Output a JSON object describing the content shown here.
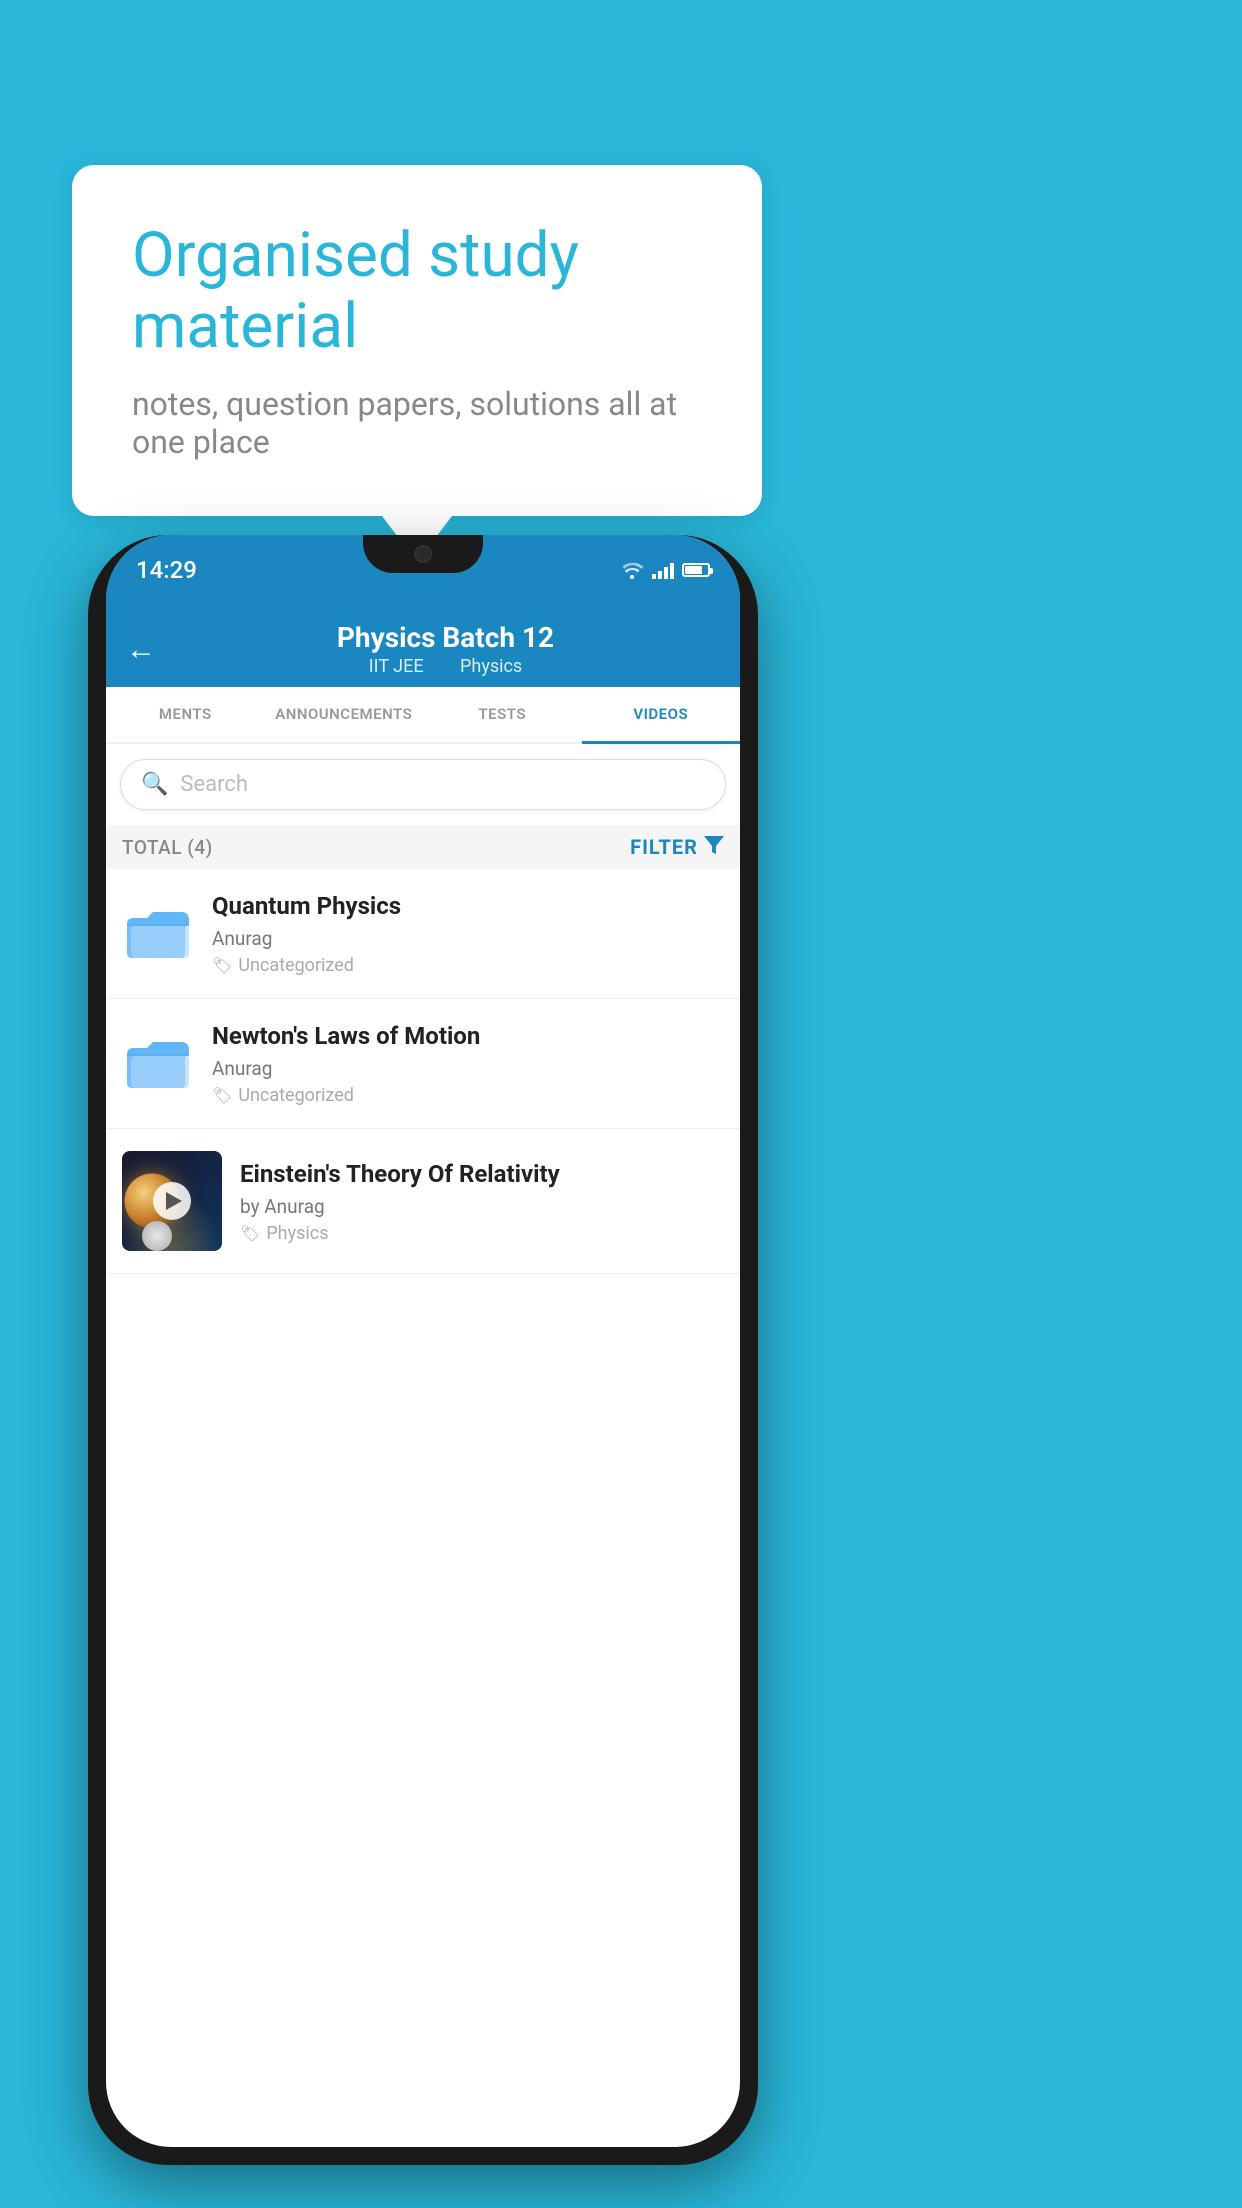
{
  "background": {
    "color": "#29B6D8"
  },
  "speech_bubble": {
    "title": "Organised study material",
    "subtitle": "notes, question papers, solutions all at one place"
  },
  "phone": {
    "status_bar": {
      "time": "14:29"
    },
    "header": {
      "title": "Physics Batch 12",
      "subtitle1": "IIT JEE",
      "subtitle2": "Physics",
      "back_label": "←"
    },
    "tabs": [
      {
        "label": "MENTS",
        "active": false
      },
      {
        "label": "ANNOUNCEMENTS",
        "active": false
      },
      {
        "label": "TESTS",
        "active": false
      },
      {
        "label": "VIDEOS",
        "active": true
      }
    ],
    "search": {
      "placeholder": "Search"
    },
    "filter_row": {
      "total_label": "TOTAL (4)",
      "filter_label": "FILTER"
    },
    "videos": [
      {
        "title": "Quantum Physics",
        "author": "Anurag",
        "tag": "Uncategorized",
        "type": "folder"
      },
      {
        "title": "Newton's Laws of Motion",
        "author": "Anurag",
        "tag": "Uncategorized",
        "type": "folder"
      },
      {
        "title": "Einstein's Theory Of Relativity",
        "author": "by Anurag",
        "tag": "Physics",
        "type": "video"
      }
    ]
  }
}
